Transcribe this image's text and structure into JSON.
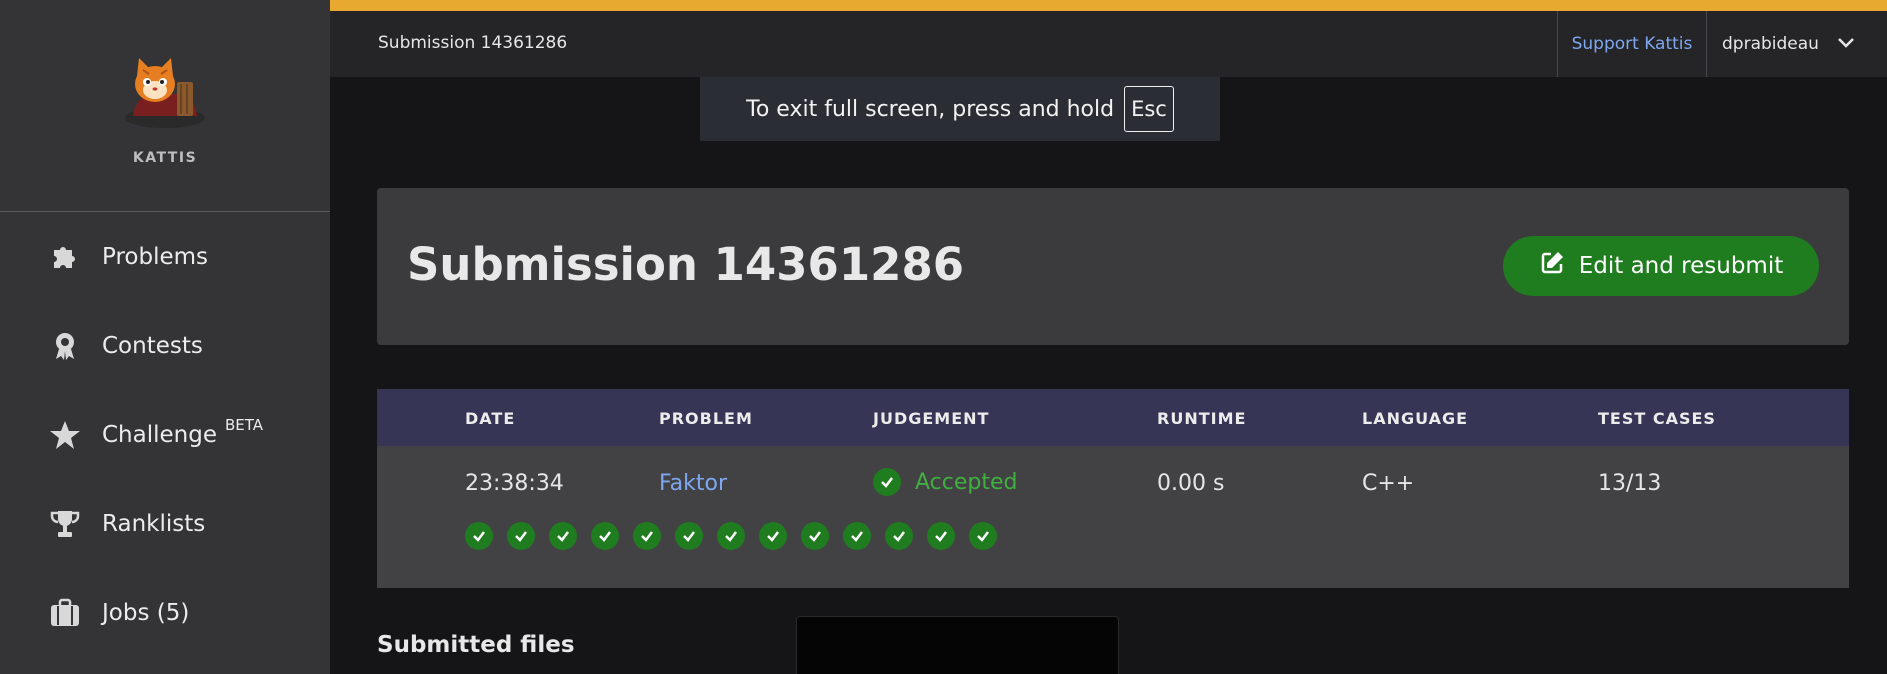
{
  "brand": {
    "name": "KATTIS"
  },
  "sidebar": {
    "items": [
      {
        "label": "Problems",
        "icon": "puzzle-icon"
      },
      {
        "label": "Contests",
        "icon": "award-icon"
      },
      {
        "label": "Challenge",
        "icon": "star-icon",
        "badge": "BETA"
      },
      {
        "label": "Ranklists",
        "icon": "trophy-icon"
      },
      {
        "label": "Jobs (5)",
        "icon": "briefcase-icon"
      }
    ]
  },
  "topbar": {
    "breadcrumb": "Submission 14361286",
    "support": "Support Kattis",
    "user": "dprabideau"
  },
  "fullscreen_toast": {
    "text": "To exit full screen, press and hold",
    "key": "Esc"
  },
  "header": {
    "title": "Submission 14361286",
    "resubmit_label": "Edit and resubmit"
  },
  "table": {
    "headers": [
      "DATE",
      "PROBLEM",
      "JUDGEMENT",
      "RUNTIME",
      "LANGUAGE",
      "TEST CASES"
    ],
    "row": {
      "date": "23:38:34",
      "problem": "Faktor",
      "judgement": "Accepted",
      "runtime": "0.00 s",
      "language": "C++",
      "test_cases": "13/13"
    },
    "test_case_results": 13
  },
  "files": {
    "title": "Submitted files"
  },
  "colors": {
    "accent": "#e8a930",
    "success": "#1f7d1f",
    "accepted_text": "#3fb03f",
    "link": "#7fa7f0",
    "table_header": "#363555"
  }
}
